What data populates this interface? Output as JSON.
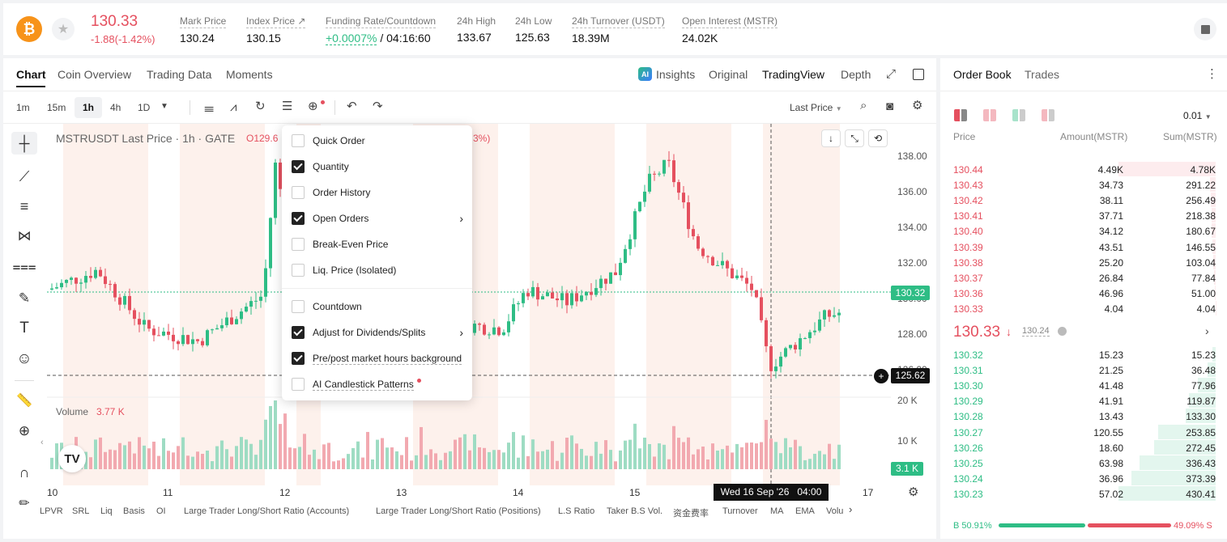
{
  "ticker": {
    "price": "130.33",
    "change": "-1.88(-1.42%)",
    "stats": [
      {
        "label": "Mark Price",
        "value": "130.24"
      },
      {
        "label": "Index Price ↗",
        "value": "130.15"
      },
      {
        "label": "Funding Rate/Countdown",
        "value": "+0.0007%",
        "value2": "/ 04:16:60"
      },
      {
        "label": "24h High",
        "value": "133.67"
      },
      {
        "label": "24h Low",
        "value": "125.63"
      },
      {
        "label": "24h Turnover (USDT)",
        "value": "18.39M"
      },
      {
        "label": "Open Interest (MSTR)",
        "value": "24.02K"
      }
    ]
  },
  "chart_tabs": [
    "Chart",
    "Coin Overview",
    "Trading Data",
    "Moments"
  ],
  "view_tabs": {
    "insights": "Insights",
    "original": "Original",
    "tradingview": "TradingView",
    "depth": "Depth"
  },
  "timeframes": [
    "1m",
    "15m",
    "1h",
    "4h",
    "1D"
  ],
  "price_source": "Last Price",
  "legend": {
    "symbol": "MSTRUSDT Last Price · 1h · GATE",
    "open": "O129.6",
    "pct": "3%)"
  },
  "menu": [
    {
      "label": "Quick Order",
      "checked": false
    },
    {
      "label": "Quantity",
      "checked": true
    },
    {
      "label": "Order History",
      "checked": false
    },
    {
      "label": "Open Orders",
      "checked": true
    },
    {
      "label": "Break-Even Price",
      "checked": false
    },
    {
      "label": "Liq. Price (Isolated)",
      "checked": false
    },
    {
      "label": "Countdown",
      "checked": false
    },
    {
      "label": "Adjust for Dividends/Splits",
      "checked": true
    },
    {
      "label": "Pre/post market hours background",
      "checked": true
    },
    {
      "label": "AI Candlestick Patterns",
      "checked": false
    }
  ],
  "y_axis": [
    "138.00",
    "136.00",
    "134.00",
    "132.00",
    "130.00",
    "128.00",
    "126.00"
  ],
  "price_tags": {
    "current": "130.32",
    "cursor": "125.62"
  },
  "volume": {
    "label": "Volume",
    "value": "3.77 K",
    "axis": [
      "20 K",
      "10 K"
    ],
    "tag": "3.1 K"
  },
  "x_axis": [
    "10",
    "11",
    "12",
    "13",
    "14",
    "15",
    "17"
  ],
  "crosshair_date": "Wed 16 Sep '26   04:00",
  "indicators": [
    "LPVR",
    "SRL",
    "Liq",
    "Basis",
    "OI",
    "Large Trader Long/Short Ratio (Accounts)",
    "Large Trader Long/Short Ratio (Positions)",
    "L.S Ratio",
    "Taker B.S Vol.",
    "资金费率",
    "Turnover",
    "MA",
    "EMA",
    "Volu"
  ],
  "orderbook": {
    "tabs": [
      "Order Book",
      "Trades"
    ],
    "precision": "0.01",
    "headers": [
      "Price",
      "Amount(MSTR)",
      "Sum(MSTR)"
    ],
    "asks": [
      [
        "130.44",
        "4.49K",
        "4.78K"
      ],
      [
        "130.43",
        "34.73",
        "291.22"
      ],
      [
        "130.42",
        "38.11",
        "256.49"
      ],
      [
        "130.41",
        "37.71",
        "218.38"
      ],
      [
        "130.40",
        "34.12",
        "180.67"
      ],
      [
        "130.39",
        "43.51",
        "146.55"
      ],
      [
        "130.38",
        "25.20",
        "103.04"
      ],
      [
        "130.37",
        "26.84",
        "77.84"
      ],
      [
        "130.36",
        "46.96",
        "51.00"
      ],
      [
        "130.33",
        "4.04",
        "4.04"
      ]
    ],
    "mid": "130.33",
    "mark": "130.24",
    "bids": [
      [
        "130.32",
        "15.23",
        "15.23"
      ],
      [
        "130.31",
        "21.25",
        "36.48"
      ],
      [
        "130.30",
        "41.48",
        "77.96"
      ],
      [
        "130.29",
        "41.91",
        "119.87"
      ],
      [
        "130.28",
        "13.43",
        "133.30"
      ],
      [
        "130.27",
        "120.55",
        "253.85"
      ],
      [
        "130.26",
        "18.60",
        "272.45"
      ],
      [
        "130.25",
        "63.98",
        "336.43"
      ],
      [
        "130.24",
        "36.96",
        "373.39"
      ],
      [
        "130.23",
        "57.02",
        "430.41"
      ]
    ],
    "buy_pct": "B 50.91%",
    "sell_pct": "49.09% S"
  },
  "colors": {
    "up": "#2ebd85",
    "down": "#e5505f",
    "accent": "#f7931a"
  }
}
